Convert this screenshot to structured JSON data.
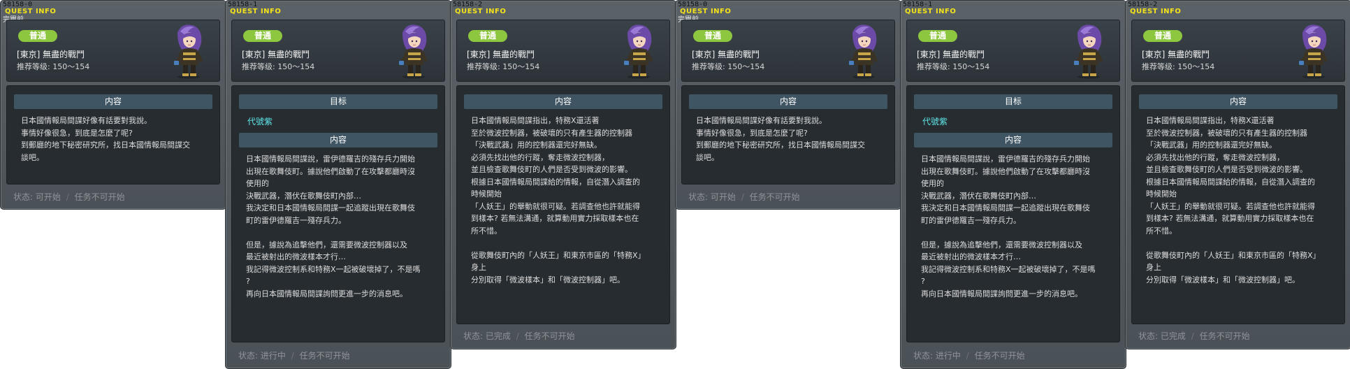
{
  "panels": [
    {
      "quest_id": "58158-0",
      "quest_info_label": "QUEST INFO",
      "extra_label": "完畢前",
      "badge": "普通",
      "title": "[東京] 無盡的戰鬥",
      "level": "推荐等级:  150～154",
      "target_head": "",
      "target_value": "",
      "content_head": "内容",
      "content": "日本國情報局間諜好像有話要對我說。\n事情好像很急，到底是怎麼了呢?\n到郵廳的地下秘密研究所，找日本國情報局間諜交\n談吧。",
      "status_label": "状态:",
      "status_value": "可开始",
      "status_sep": "/",
      "status_extra": "任务不可开始"
    },
    {
      "quest_id": "58158-1",
      "quest_info_label": "QUEST INFO",
      "extra_label": "",
      "badge": "普通",
      "title": "[東京] 無盡的戰鬥",
      "level": "推荐等级:  150～154",
      "target_head": "目标",
      "target_value": "代號紫",
      "content_head": "内容",
      "content": "日本國情報局間諜說，雷伊德羅吉的殘存兵力開始\n出現在歌舞伎町。據說他們啟動了在攻擊都廳時沒\n使用的\n決戰武器，潛伏在歌舞伎町內部…\n我決定和日本國情報局間諜一起追蹤出現在歌舞伎\n町的雷伊德羅吉一殘存兵力。\n\n但是，據說為追擊他們，還需要微波控制器以及\n最近被射出的微波樣本才行…\n我記得微波控制系和特務X一起被破壞掉了，不是嗎\n?\n再向日本國情報局間諜詢問更進一步的消息吧。",
      "status_label": "状态:",
      "status_value": "进行中",
      "status_sep": "/",
      "status_extra": "任务不可开始"
    },
    {
      "quest_id": "58158-2",
      "quest_info_label": "QUEST INFO",
      "extra_label": "",
      "badge": "普通",
      "title": "[東京] 無盡的戰鬥",
      "level": "推荐等级:  150～154",
      "target_head": "",
      "target_value": "",
      "content_head": "内容",
      "content": "日本國情報局間諜指出，特務X還活著\n至於微波控制器，被破壞的只有產生器的控制器\n「決戰武器」用的控制器還完好無缺。\n必須先找出他的行蹤，奪走微波控制器，\n並且檢查歌舞伎町的人們是否受到微波的影響。\n根據日本國情報局間諜給的情報，自從潛入調查的\n時候開始\n「人妖王」的舉動就很可疑。若調查他也許就能得\n到樣本? 若無法溝通，就算動用實力採取樣本也在\n所不惜。\n\n從歌舞伎町內的「人妖王」和東京市區的「特務X」\n身上\n分別取得「微波樣本」和「微波控制器」吧。",
      "status_label": "状态:",
      "status_value": "已完成",
      "status_sep": "/",
      "status_extra": "任务不可开始"
    },
    {
      "quest_id": "58158-0",
      "quest_info_label": "QUEST INFO",
      "extra_label": "完畢前",
      "badge": "普通",
      "title": "[東京] 無盡的戰鬥",
      "level": "推荐等级:  150～154",
      "target_head": "",
      "target_value": "",
      "content_head": "内容",
      "content": "日本國情報局間諜好像有話要對我說。\n事情好像很急，到底是怎麼了呢?\n到郵廳的地下秘密研究所，找日本國情報局間諜交\n談吧。",
      "status_label": "状态:",
      "status_value": "可开始",
      "status_sep": "/",
      "status_extra": "任务不可开始"
    },
    {
      "quest_id": "58158-1",
      "quest_info_label": "QUEST INFO",
      "extra_label": "",
      "badge": "普通",
      "title": "[東京] 無盡的戰鬥",
      "level": "推荐等级:  150～154",
      "target_head": "目标",
      "target_value": "代號紫",
      "content_head": "内容",
      "content": "日本國情報局間諜說，雷伊德羅吉的殘存兵力開始\n出現在歌舞伎町。據說他們啟動了在攻擊都廳時沒\n使用的\n決戰武器，潛伏在歌舞伎町內部…\n我決定和日本國情報局間諜一起追蹤出現在歌舞伎\n町的雷伊德羅吉一殘存兵力。\n\n但是，據說為追擊他們，還需要微波控制器以及\n最近被射出的微波樣本才行…\n我記得微波控制系和特務X一起被破壞掉了，不是嗎\n?\n再向日本國情報局間諜詢問更進一步的消息吧。",
      "status_label": "状态:",
      "status_value": "进行中",
      "status_sep": "/",
      "status_extra": "任务不可开始"
    },
    {
      "quest_id": "58158-2",
      "quest_info_label": "QUEST INFO",
      "extra_label": "",
      "badge": "普通",
      "title": "[東京] 無盡的戰鬥",
      "level": "推荐等级:  150～154",
      "target_head": "",
      "target_value": "",
      "content_head": "内容",
      "content": "日本國情報局間諜指出，特務X還活著\n至於微波控制器，被破壞的只有產生器的控制器\n「決戰武器」用的控制器還完好無缺。\n必須先找出他的行蹤，奪走微波控制器，\n並且檢查歌舞伎町的人們是否受到微波的影響。\n根據日本國情報局間諜給的情報，自從潛入調查的\n時候開始\n「人妖王」的舉動就很可疑。若調查他也許就能得\n到樣本? 若無法溝通，就算動用實力採取樣本也在\n所不惜。\n\n從歌舞伎町內的「人妖王」和東京市區的「特務X」\n身上\n分別取得「微波樣本」和「微波控制器」吧。",
      "status_label": "状态:",
      "status_value": "已完成",
      "status_sep": "/",
      "status_extra": "任务不可开始"
    }
  ],
  "colors": {
    "quest_info": "#f3e21a",
    "badge": "#8dc63f",
    "target": "#5ee6e6",
    "section_head": "#3f5563"
  },
  "icons": {
    "avatar": "npc-portrait-purple-hair-agent"
  }
}
